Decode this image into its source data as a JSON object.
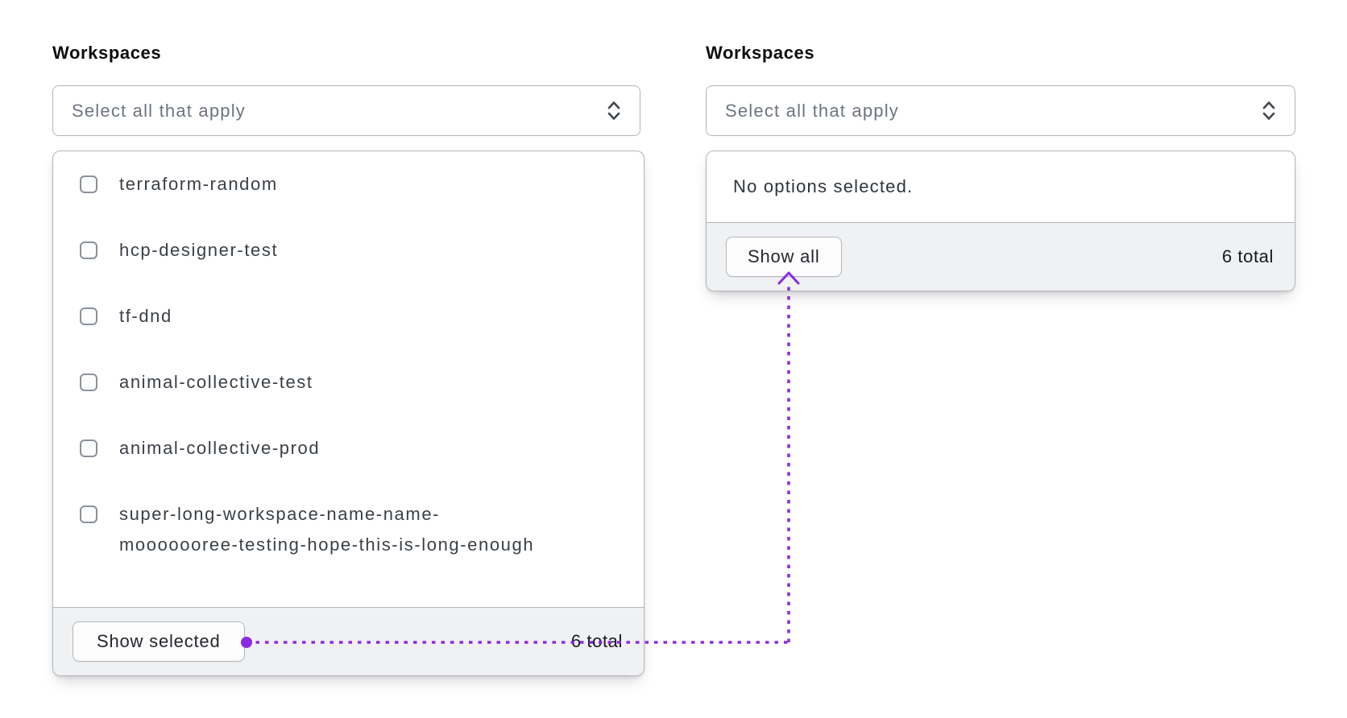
{
  "left_panel": {
    "label": "Workspaces",
    "trigger": {
      "placeholder": "Select all that apply",
      "icon": "unfold-caret-icon"
    },
    "options": [
      {
        "label": "terraform-random",
        "checked": false
      },
      {
        "label": "hcp-designer-test",
        "checked": false
      },
      {
        "label": "tf-dnd",
        "checked": false
      },
      {
        "label": "animal-collective-test",
        "checked": false
      },
      {
        "label": "animal-collective-prod",
        "checked": false
      },
      {
        "label": "super-long-workspace-name-name-mooooooree-testing-hope-this-is-long-enough",
        "checked": false
      }
    ],
    "footer": {
      "button_label": "Show selected",
      "total_label": "6 total"
    }
  },
  "right_panel": {
    "label": "Workspaces",
    "trigger": {
      "placeholder": "Select all that apply",
      "icon": "unfold-caret-icon"
    },
    "empty_message": "No options selected.",
    "footer": {
      "button_label": "Show all",
      "total_label": "6 total"
    }
  },
  "annotation": {
    "description": "dotted connector from Show selected button to Show all button",
    "color": "#8b2be2"
  },
  "colors": {
    "annotation-purple": "#8b2be2",
    "footer-bg": "#f0f1f3",
    "panel-border": "#b2b6bd",
    "text-muted": "#6d7480"
  }
}
